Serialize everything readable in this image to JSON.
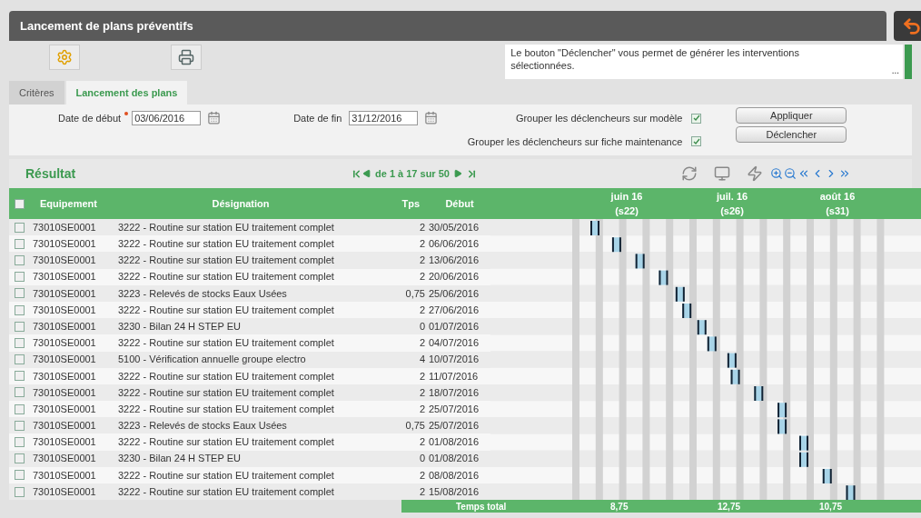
{
  "window": {
    "title": "Lancement de plans préventifs"
  },
  "info": {
    "text": "Le bouton \"Déclencher\" vous permet de générer les interventions sélectionnées.",
    "more": "..."
  },
  "tabs": [
    {
      "label": "Critères",
      "selected": false
    },
    {
      "label": "Lancement des plans",
      "selected": true
    }
  ],
  "form": {
    "start_label": "Date de début",
    "start_required": true,
    "start_value": "03/06/2016",
    "end_label": "Date de fin",
    "end_value": "31/12/2016",
    "options": [
      {
        "label": "Grouper les déclencheurs sur modèle",
        "checked": true
      },
      {
        "label": "Grouper les déclencheurs sur fiche maintenance",
        "checked": true
      }
    ],
    "buttons": [
      "Appliquer",
      "Déclencher"
    ]
  },
  "result": {
    "title": "Résultat",
    "pager": "de 1 à 17 sur 50"
  },
  "table": {
    "select_all": false,
    "columns": [
      "Equipement",
      "Désignation",
      "Tps",
      "Début"
    ],
    "months": [
      {
        "label": "juin 16",
        "week": "(s22)"
      },
      {
        "label": "juil. 16",
        "week": "(s26)"
      },
      {
        "label": "août 16",
        "week": "(s31)"
      }
    ],
    "rows": [
      {
        "equipment": "73010SE0001",
        "designation": "3222 - Routine sur station EU traitement complet",
        "tps": "2",
        "start": "30/05/2016",
        "checked": false
      },
      {
        "equipment": "73010SE0001",
        "designation": "3222 - Routine sur station EU traitement complet",
        "tps": "2",
        "start": "06/06/2016",
        "checked": false
      },
      {
        "equipment": "73010SE0001",
        "designation": "3222 - Routine sur station EU traitement complet",
        "tps": "2",
        "start": "13/06/2016",
        "checked": false
      },
      {
        "equipment": "73010SE0001",
        "designation": "3222 - Routine sur station EU traitement complet",
        "tps": "2",
        "start": "20/06/2016",
        "checked": false
      },
      {
        "equipment": "73010SE0001",
        "designation": "3223 - Relevés de stocks Eaux Usées",
        "tps": "0,75",
        "start": "25/06/2016",
        "checked": false
      },
      {
        "equipment": "73010SE0001",
        "designation": "3222 - Routine sur station EU traitement complet",
        "tps": "2",
        "start": "27/06/2016",
        "checked": false
      },
      {
        "equipment": "73010SE0001",
        "designation": "3230 - Bilan 24 H STEP EU",
        "tps": "0",
        "start": "01/07/2016",
        "checked": false
      },
      {
        "equipment": "73010SE0001",
        "designation": "3222 - Routine sur station EU traitement complet",
        "tps": "2",
        "start": "04/07/2016",
        "checked": false
      },
      {
        "equipment": "73010SE0001",
        "designation": "5100 - Vérification annuelle groupe electro",
        "tps": "4",
        "start": "10/07/2016",
        "checked": false
      },
      {
        "equipment": "73010SE0001",
        "designation": "3222 - Routine sur station EU traitement complet",
        "tps": "2",
        "start": "11/07/2016",
        "checked": false
      },
      {
        "equipment": "73010SE0001",
        "designation": "3222 - Routine sur station EU traitement complet",
        "tps": "2",
        "start": "18/07/2016",
        "checked": false
      },
      {
        "equipment": "73010SE0001",
        "designation": "3222 - Routine sur station EU traitement complet",
        "tps": "2",
        "start": "25/07/2016",
        "checked": false
      },
      {
        "equipment": "73010SE0001",
        "designation": "3223 - Relevés de stocks Eaux Usées",
        "tps": "0,75",
        "start": "25/07/2016",
        "checked": false
      },
      {
        "equipment": "73010SE0001",
        "designation": "3222 - Routine sur station EU traitement complet",
        "tps": "2",
        "start": "01/08/2016",
        "checked": false
      },
      {
        "equipment": "73010SE0001",
        "designation": "3230 - Bilan 24 H STEP EU",
        "tps": "0",
        "start": "01/08/2016",
        "checked": false
      },
      {
        "equipment": "73010SE0001",
        "designation": "3222 - Routine sur station EU traitement complet",
        "tps": "2",
        "start": "08/08/2016",
        "checked": false
      },
      {
        "equipment": "73010SE0001",
        "designation": "3222 - Routine sur station EU traitement complet",
        "tps": "2",
        "start": "15/08/2016",
        "checked": false
      }
    ],
    "footer": {
      "label": "Temps total",
      "totals": [
        "8,75",
        "12,75",
        "10,75"
      ]
    }
  }
}
